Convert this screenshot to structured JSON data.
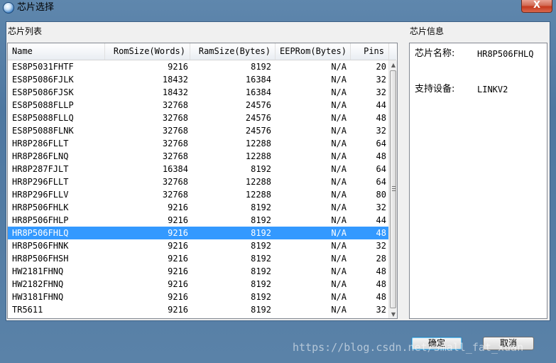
{
  "window": {
    "title": "芯片选择",
    "close_label": "X"
  },
  "chip_list": {
    "title": "芯片列表",
    "columns": [
      "Name",
      "RomSize(Words)",
      "RamSize(Bytes)",
      "EEPRom(Bytes)",
      "Pins"
    ],
    "selected_index": 13,
    "rows": [
      [
        "ES8P5031FHTF",
        "9216",
        "8192",
        "N/A",
        "20"
      ],
      [
        "ES8P5086FJLK",
        "18432",
        "16384",
        "N/A",
        "32"
      ],
      [
        "ES8P5086FJSK",
        "18432",
        "16384",
        "N/A",
        "32"
      ],
      [
        "ES8P5088FLLP",
        "32768",
        "24576",
        "N/A",
        "44"
      ],
      [
        "ES8P5088FLLQ",
        "32768",
        "24576",
        "N/A",
        "48"
      ],
      [
        "ES8P5088FLNK",
        "32768",
        "24576",
        "N/A",
        "32"
      ],
      [
        "HR8P286FLLT",
        "32768",
        "12288",
        "N/A",
        "64"
      ],
      [
        "HR8P286FLNQ",
        "32768",
        "12288",
        "N/A",
        "48"
      ],
      [
        "HR8P287FJLT",
        "16384",
        "8192",
        "N/A",
        "64"
      ],
      [
        "HR8P296FLLT",
        "32768",
        "12288",
        "N/A",
        "64"
      ],
      [
        "HR8P296FLLV",
        "32768",
        "12288",
        "N/A",
        "80"
      ],
      [
        "HR8P506FHLK",
        "9216",
        "8192",
        "N/A",
        "32"
      ],
      [
        "HR8P506FHLP",
        "9216",
        "8192",
        "N/A",
        "44"
      ],
      [
        "HR8P506FHLQ",
        "9216",
        "8192",
        "N/A",
        "48"
      ],
      [
        "HR8P506FHNK",
        "9216",
        "8192",
        "N/A",
        "32"
      ],
      [
        "HR8P506FHSH",
        "9216",
        "8192",
        "N/A",
        "28"
      ],
      [
        "HW2181FHNQ",
        "9216",
        "8192",
        "N/A",
        "48"
      ],
      [
        "HW2182FHNQ",
        "9216",
        "8192",
        "N/A",
        "48"
      ],
      [
        "HW3181FHNQ",
        "9216",
        "8192",
        "N/A",
        "48"
      ],
      [
        "TR5611",
        "9216",
        "8192",
        "N/A",
        "32"
      ]
    ]
  },
  "chip_info": {
    "title": "芯片信息",
    "name_label": "芯片名称:",
    "name_value": "HR8P506FHLQ",
    "device_label": "支持设备:",
    "device_value": "LINKV2"
  },
  "buttons": {
    "ok": "确定",
    "cancel": "取消"
  },
  "watermark": "https://blog.csdn.net/Small_fat_xuan",
  "colors": {
    "selection": "#3399ff",
    "frame": "#5a82a8"
  }
}
